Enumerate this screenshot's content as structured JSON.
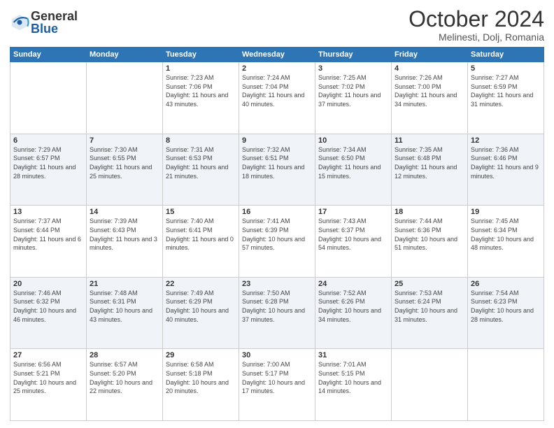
{
  "header": {
    "logo_general": "General",
    "logo_blue": "Blue",
    "month": "October 2024",
    "location": "Melinesti, Dolj, Romania"
  },
  "weekdays": [
    "Sunday",
    "Monday",
    "Tuesday",
    "Wednesday",
    "Thursday",
    "Friday",
    "Saturday"
  ],
  "weeks": [
    [
      {
        "day": "",
        "info": ""
      },
      {
        "day": "",
        "info": ""
      },
      {
        "day": "1",
        "info": "Sunrise: 7:23 AM\nSunset: 7:06 PM\nDaylight: 11 hours and 43 minutes."
      },
      {
        "day": "2",
        "info": "Sunrise: 7:24 AM\nSunset: 7:04 PM\nDaylight: 11 hours and 40 minutes."
      },
      {
        "day": "3",
        "info": "Sunrise: 7:25 AM\nSunset: 7:02 PM\nDaylight: 11 hours and 37 minutes."
      },
      {
        "day": "4",
        "info": "Sunrise: 7:26 AM\nSunset: 7:00 PM\nDaylight: 11 hours and 34 minutes."
      },
      {
        "day": "5",
        "info": "Sunrise: 7:27 AM\nSunset: 6:59 PM\nDaylight: 11 hours and 31 minutes."
      }
    ],
    [
      {
        "day": "6",
        "info": "Sunrise: 7:29 AM\nSunset: 6:57 PM\nDaylight: 11 hours and 28 minutes."
      },
      {
        "day": "7",
        "info": "Sunrise: 7:30 AM\nSunset: 6:55 PM\nDaylight: 11 hours and 25 minutes."
      },
      {
        "day": "8",
        "info": "Sunrise: 7:31 AM\nSunset: 6:53 PM\nDaylight: 11 hours and 21 minutes."
      },
      {
        "day": "9",
        "info": "Sunrise: 7:32 AM\nSunset: 6:51 PM\nDaylight: 11 hours and 18 minutes."
      },
      {
        "day": "10",
        "info": "Sunrise: 7:34 AM\nSunset: 6:50 PM\nDaylight: 11 hours and 15 minutes."
      },
      {
        "day": "11",
        "info": "Sunrise: 7:35 AM\nSunset: 6:48 PM\nDaylight: 11 hours and 12 minutes."
      },
      {
        "day": "12",
        "info": "Sunrise: 7:36 AM\nSunset: 6:46 PM\nDaylight: 11 hours and 9 minutes."
      }
    ],
    [
      {
        "day": "13",
        "info": "Sunrise: 7:37 AM\nSunset: 6:44 PM\nDaylight: 11 hours and 6 minutes."
      },
      {
        "day": "14",
        "info": "Sunrise: 7:39 AM\nSunset: 6:43 PM\nDaylight: 11 hours and 3 minutes."
      },
      {
        "day": "15",
        "info": "Sunrise: 7:40 AM\nSunset: 6:41 PM\nDaylight: 11 hours and 0 minutes."
      },
      {
        "day": "16",
        "info": "Sunrise: 7:41 AM\nSunset: 6:39 PM\nDaylight: 10 hours and 57 minutes."
      },
      {
        "day": "17",
        "info": "Sunrise: 7:43 AM\nSunset: 6:37 PM\nDaylight: 10 hours and 54 minutes."
      },
      {
        "day": "18",
        "info": "Sunrise: 7:44 AM\nSunset: 6:36 PM\nDaylight: 10 hours and 51 minutes."
      },
      {
        "day": "19",
        "info": "Sunrise: 7:45 AM\nSunset: 6:34 PM\nDaylight: 10 hours and 48 minutes."
      }
    ],
    [
      {
        "day": "20",
        "info": "Sunrise: 7:46 AM\nSunset: 6:32 PM\nDaylight: 10 hours and 46 minutes."
      },
      {
        "day": "21",
        "info": "Sunrise: 7:48 AM\nSunset: 6:31 PM\nDaylight: 10 hours and 43 minutes."
      },
      {
        "day": "22",
        "info": "Sunrise: 7:49 AM\nSunset: 6:29 PM\nDaylight: 10 hours and 40 minutes."
      },
      {
        "day": "23",
        "info": "Sunrise: 7:50 AM\nSunset: 6:28 PM\nDaylight: 10 hours and 37 minutes."
      },
      {
        "day": "24",
        "info": "Sunrise: 7:52 AM\nSunset: 6:26 PM\nDaylight: 10 hours and 34 minutes."
      },
      {
        "day": "25",
        "info": "Sunrise: 7:53 AM\nSunset: 6:24 PM\nDaylight: 10 hours and 31 minutes."
      },
      {
        "day": "26",
        "info": "Sunrise: 7:54 AM\nSunset: 6:23 PM\nDaylight: 10 hours and 28 minutes."
      }
    ],
    [
      {
        "day": "27",
        "info": "Sunrise: 6:56 AM\nSunset: 5:21 PM\nDaylight: 10 hours and 25 minutes."
      },
      {
        "day": "28",
        "info": "Sunrise: 6:57 AM\nSunset: 5:20 PM\nDaylight: 10 hours and 22 minutes."
      },
      {
        "day": "29",
        "info": "Sunrise: 6:58 AM\nSunset: 5:18 PM\nDaylight: 10 hours and 20 minutes."
      },
      {
        "day": "30",
        "info": "Sunrise: 7:00 AM\nSunset: 5:17 PM\nDaylight: 10 hours and 17 minutes."
      },
      {
        "day": "31",
        "info": "Sunrise: 7:01 AM\nSunset: 5:15 PM\nDaylight: 10 hours and 14 minutes."
      },
      {
        "day": "",
        "info": ""
      },
      {
        "day": "",
        "info": ""
      }
    ]
  ]
}
